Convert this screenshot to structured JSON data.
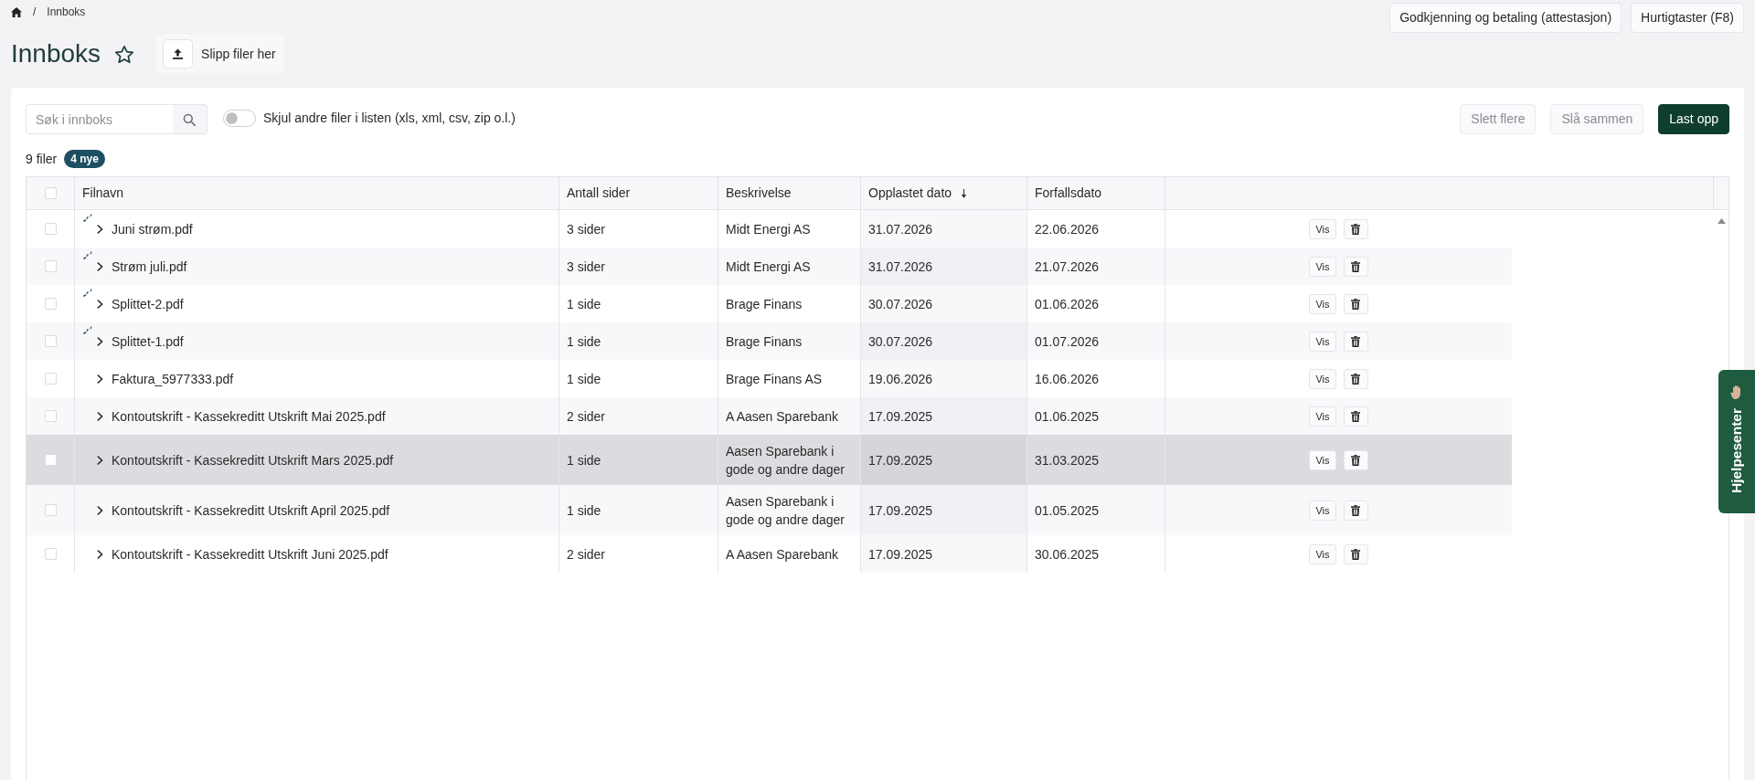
{
  "breadcrumb": {
    "separator": "/",
    "items": [
      {
        "label": "Innboks"
      }
    ]
  },
  "header_buttons": [
    {
      "label": "Godkjenning og betaling (attestasjon)"
    },
    {
      "label": "Hurtigtaster (F8)"
    }
  ],
  "page": {
    "title": "Innboks",
    "favorite": false,
    "dropzone_label": "Slipp filer her"
  },
  "toolbar": {
    "search": {
      "placeholder": "Søk i innboks"
    },
    "filter_toggle": {
      "label": "Skjul andre filer i listen (xls, xml, csv, zip o.l.)",
      "on": false
    },
    "buttons": [
      {
        "label": "Slett flere",
        "kind": "secondary",
        "disabled": true
      },
      {
        "label": "Slå sammen",
        "kind": "secondary",
        "disabled": true
      },
      {
        "label": "Last opp",
        "kind": "primary",
        "disabled": false
      }
    ]
  },
  "summary": {
    "count": "9 filer",
    "badge": "4 nye"
  },
  "table": {
    "select_all": {
      "checked": false
    },
    "columns": [
      {
        "label": "Filnavn",
        "sorted": false
      },
      {
        "label": "Antall sider",
        "sorted": false
      },
      {
        "label": "Beskrivelse",
        "sorted": false
      },
      {
        "label": "Opplastet dato",
        "sorted": true
      },
      {
        "label": "Forfallsdato",
        "sorted": false
      }
    ],
    "rows": [
      {
        "checked": false,
        "expanded": false,
        "processing": true,
        "highlighted": false,
        "cells": [
          "Juni strøm.pdf",
          "3 sider",
          "Midt Energi AS",
          "31.07.2026",
          "22.06.2026"
        ],
        "view_label": "Vis"
      },
      {
        "checked": false,
        "expanded": false,
        "processing": true,
        "highlighted": false,
        "cells": [
          "Strøm juli.pdf",
          "3 sider",
          "Midt Energi AS",
          "31.07.2026",
          "21.07.2026"
        ],
        "view_label": "Vis"
      },
      {
        "checked": false,
        "expanded": false,
        "processing": true,
        "highlighted": false,
        "cells": [
          "Splittet-2.pdf",
          "1 side",
          "Brage Finans",
          "30.07.2026",
          "01.06.2026"
        ],
        "view_label": "Vis"
      },
      {
        "checked": false,
        "expanded": false,
        "processing": true,
        "highlighted": false,
        "cells": [
          "Splittet-1.pdf",
          "1 side",
          "Brage Finans",
          "30.07.2026",
          "01.07.2026"
        ],
        "view_label": "Vis"
      },
      {
        "checked": false,
        "expanded": false,
        "processing": false,
        "highlighted": false,
        "cells": [
          "Faktura_5977333.pdf",
          "1 side",
          "Brage Finans AS",
          "19.06.2026",
          "16.06.2026"
        ],
        "view_label": "Vis"
      },
      {
        "checked": false,
        "expanded": false,
        "processing": false,
        "highlighted": false,
        "cells": [
          "Kontoutskrift - Kassekreditt Utskrift Mai 2025.pdf",
          "2 sider",
          "A Aasen Sparebank",
          "17.09.2025",
          "01.06.2025"
        ],
        "view_label": "Vis"
      },
      {
        "checked": false,
        "expanded": false,
        "processing": false,
        "highlighted": true,
        "cells": [
          "Kontoutskrift - Kassekreditt Utskrift Mars 2025.pdf",
          "1 side",
          "Aasen Sparebank i gode og andre dager",
          "17.09.2025",
          "31.03.2025"
        ],
        "view_label": "Vis"
      },
      {
        "checked": false,
        "expanded": false,
        "processing": false,
        "highlighted": false,
        "cells": [
          "Kontoutskrift - Kassekreditt Utskrift April 2025.pdf",
          "1 side",
          "Aasen Sparebank i gode og andre dager",
          "17.09.2025",
          "01.05.2025"
        ],
        "view_label": "Vis"
      },
      {
        "checked": false,
        "expanded": false,
        "processing": false,
        "highlighted": false,
        "cells": [
          "Kontoutskrift - Kassekreditt Utskrift Juni 2025.pdf",
          "2 sider",
          "A Aasen Sparebank",
          "17.09.2025",
          "30.06.2025"
        ],
        "view_label": "Vis"
      }
    ]
  },
  "help_tab": {
    "label": "Hjelpesenter"
  }
}
